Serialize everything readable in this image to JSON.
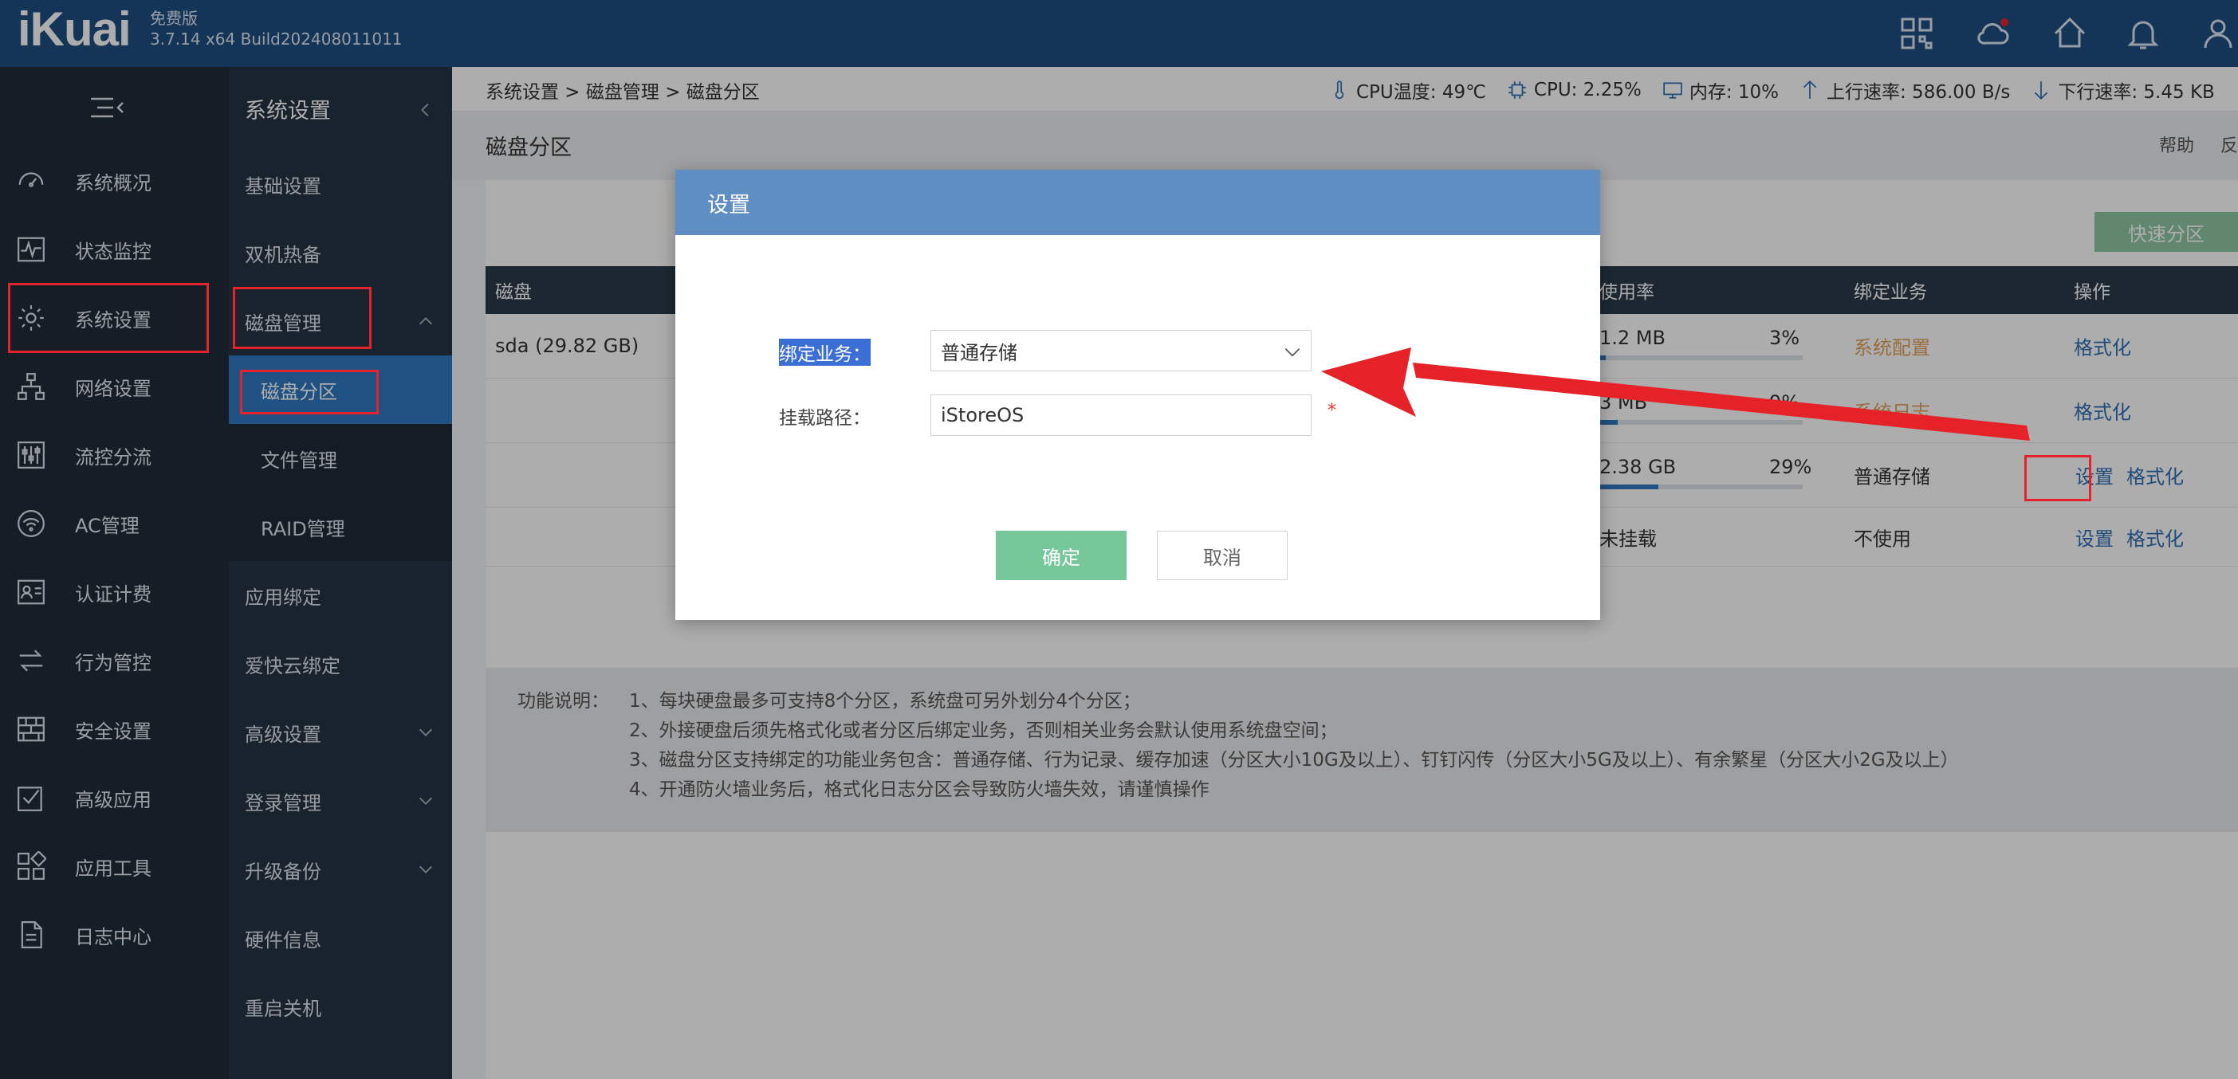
{
  "header": {
    "logo": "iKuai",
    "edition": "免费版",
    "version": "3.7.14 x64 Build202408011011"
  },
  "nav_primary": [
    {
      "label": "系统概况",
      "icon": "gauge-icon"
    },
    {
      "label": "状态监控",
      "icon": "pulse-icon"
    },
    {
      "label": "系统设置",
      "icon": "gear-icon"
    },
    {
      "label": "网络设置",
      "icon": "network-icon"
    },
    {
      "label": "流控分流",
      "icon": "sliders-icon"
    },
    {
      "label": "AC管理",
      "icon": "wifi-icon"
    },
    {
      "label": "认证计费",
      "icon": "id-card-icon"
    },
    {
      "label": "行为管控",
      "icon": "swap-icon"
    },
    {
      "label": "安全设置",
      "icon": "firewall-icon"
    },
    {
      "label": "高级应用",
      "icon": "check-box-icon"
    },
    {
      "label": "应用工具",
      "icon": "apps-icon"
    },
    {
      "label": "日志中心",
      "icon": "document-icon"
    }
  ],
  "nav_secondary": {
    "title": "系统设置",
    "items": [
      {
        "label": "基础设置"
      },
      {
        "label": "双机热备"
      },
      {
        "label": "磁盘管理"
      },
      {
        "label": "磁盘分区"
      },
      {
        "label": "文件管理"
      },
      {
        "label": "RAID管理"
      },
      {
        "label": "应用绑定"
      },
      {
        "label": "爱快云绑定"
      },
      {
        "label": "高级设置"
      },
      {
        "label": "登录管理"
      },
      {
        "label": "升级备份"
      },
      {
        "label": "硬件信息"
      },
      {
        "label": "重启关机"
      }
    ]
  },
  "breadcrumb": "系统设置 > 磁盘管理 > 磁盘分区",
  "stats": {
    "cpu_temp": "CPU温度: 49℃",
    "cpu": "CPU: 2.25%",
    "memory": "内存: 10%",
    "upload": "上行速率: 586.00 B/s",
    "download": "下行速率: 5.45 KB"
  },
  "page": {
    "title": "磁盘分区",
    "help": "帮助",
    "feedback": "反",
    "quick_partition": "快速分区"
  },
  "table": {
    "columns": {
      "disk": "磁盘",
      "usage": "使用率",
      "binding": "绑定业务",
      "action": "操作"
    },
    "rows": [
      {
        "disk": "sda (29.82 GB)",
        "used": "1.2 MB",
        "percent": "3%",
        "fill": 0.03,
        "binding": "系统配置",
        "actions": [
          "格式化"
        ]
      },
      {
        "disk": "",
        "used": "3 MB",
        "percent": "9%",
        "fill": 0.09,
        "binding": "系统日志",
        "actions": [
          "格式化"
        ]
      },
      {
        "disk": "",
        "used": "2.38 GB",
        "percent": "29%",
        "fill": 0.29,
        "binding": "普通存储",
        "actions": [
          "设置",
          "格式化"
        ]
      },
      {
        "disk": "",
        "used": "未挂载",
        "percent": "",
        "fill": 0,
        "binding": "不使用",
        "actions": [
          "设置",
          "格式化"
        ]
      }
    ]
  },
  "notes": {
    "label": "功能说明：",
    "lines": [
      "1、每块硬盘最多可支持8个分区，系统盘可另外划分4个分区；",
      "2、外接硬盘后须先格式化或者分区后绑定业务，否则相关业务会默认使用系统盘空间；",
      "3、磁盘分区支持绑定的功能业务包含：普通存储、行为记录、缓存加速（分区大小10G及以上）、钉钉闪传（分区大小5G及以上）、有余繁星（分区大小2G及以上）",
      "4、开通防火墙业务后，格式化日志分区会导致防火墙失效，请谨慎操作"
    ]
  },
  "dialog": {
    "title": "设置",
    "binding_label": "绑定业务：",
    "binding_value": "普通存储",
    "mount_label": "挂载路径：",
    "mount_value": "iStoreOS",
    "required_mark": "*",
    "ok": "确定",
    "cancel": "取消"
  },
  "colors": {
    "header": "#1e4f82",
    "nav_dark": "#1f2b38",
    "nav_active": "#2f78c0",
    "dialog_header": "#5f8ec3",
    "ok_button": "#76c89a",
    "highlight": "#e2232b"
  }
}
